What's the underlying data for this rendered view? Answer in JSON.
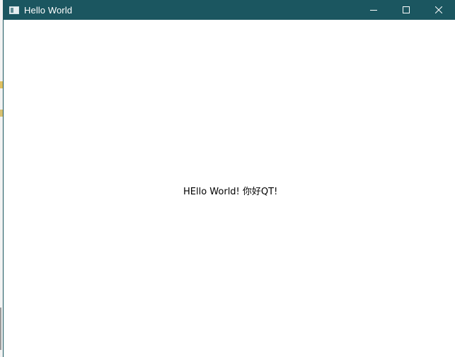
{
  "window": {
    "title": "Hello World",
    "icon": "app-window-icon",
    "accent_color": "#1b5660"
  },
  "controls": {
    "minimize_icon": "minimize-icon",
    "maximize_icon": "maximize-icon",
    "close_icon": "close-icon"
  },
  "content": {
    "label_text": "HEllo World! 你好QT!"
  }
}
